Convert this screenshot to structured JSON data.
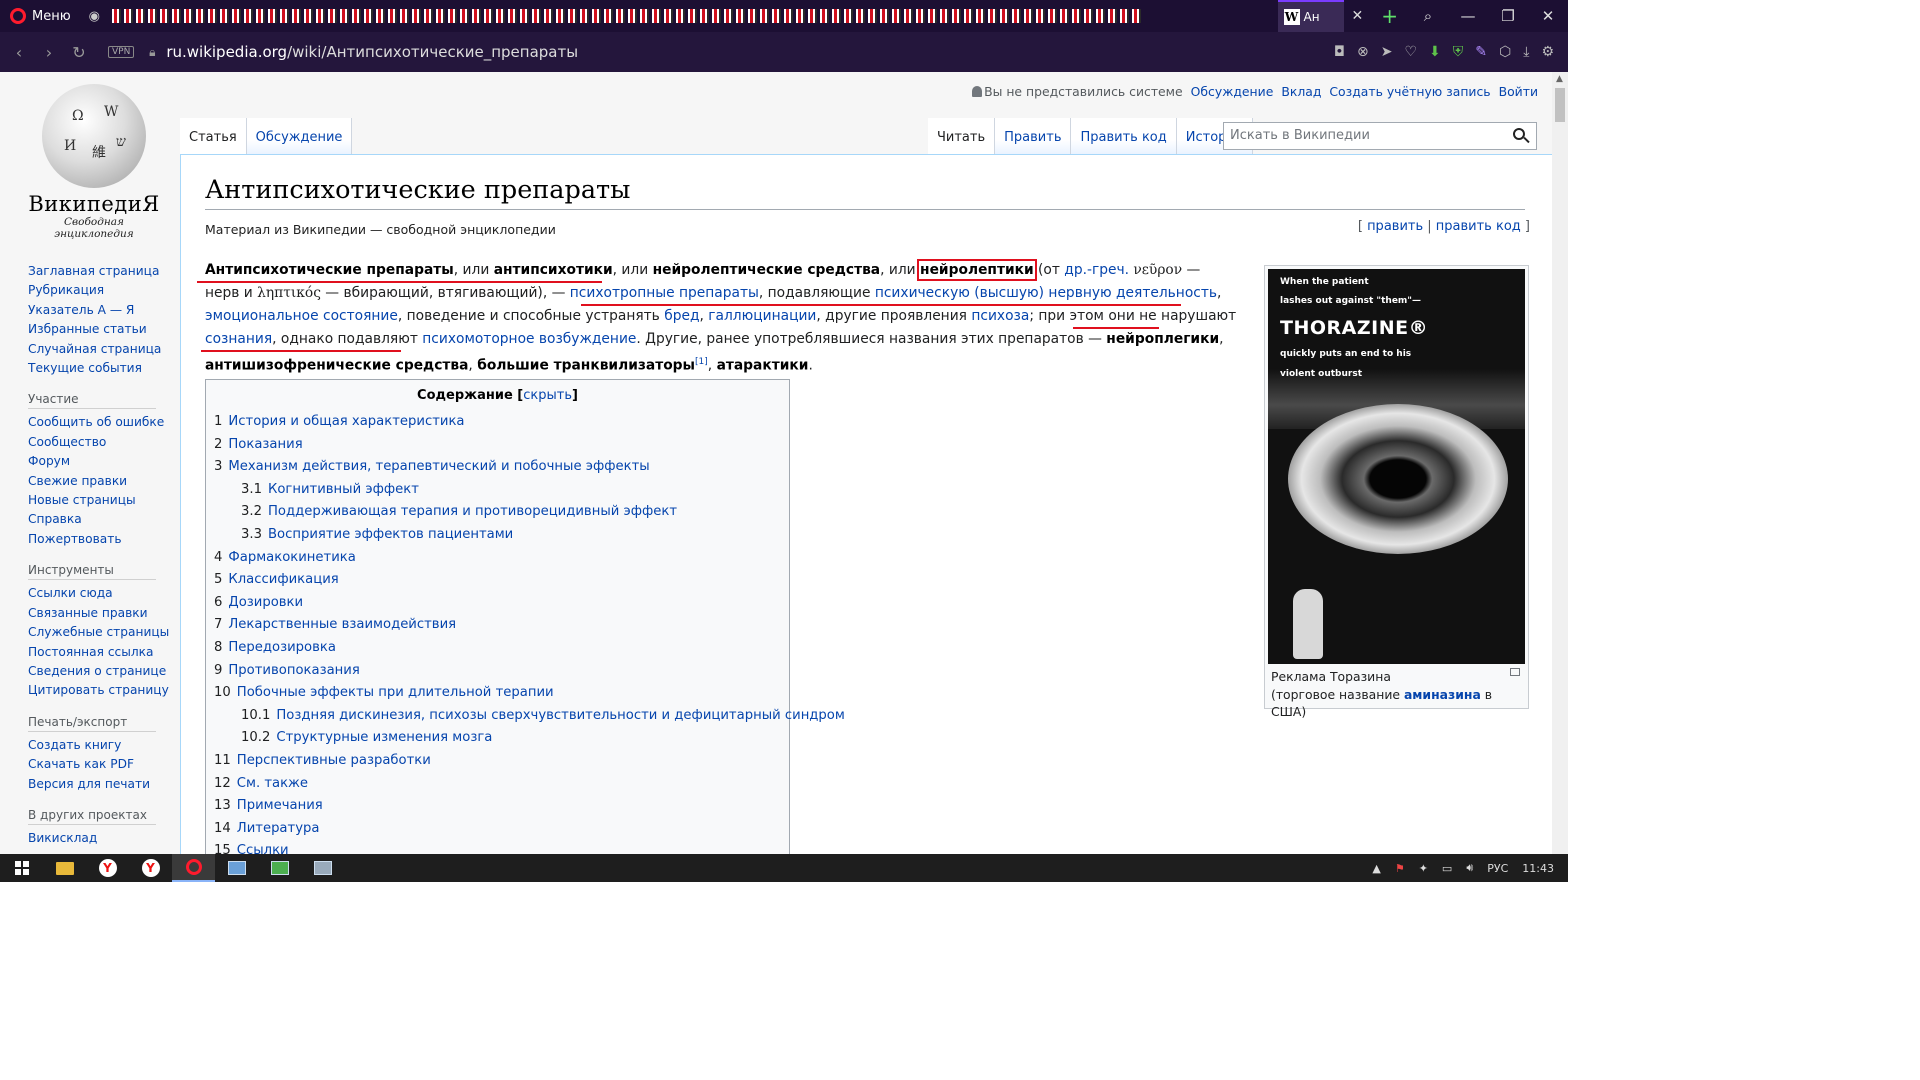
{
  "browser": {
    "menu_label": "Меню",
    "active_tab_title": "Ан",
    "url_host": "ru.wikipedia.org",
    "url_path": "/wiki/Антипсихотические_препараты",
    "vpn_label": "VPN"
  },
  "wiki": {
    "logo_title": "ВикипедиЯ",
    "logo_subtitle": "Свободная энциклопедия",
    "nav_main": [
      "Заглавная страница",
      "Рубрикация",
      "Указатель А — Я",
      "Избранные статьи",
      "Случайная страница",
      "Текущие события"
    ],
    "participation_heading": "Участие",
    "nav_participation": [
      "Сообщить об ошибке",
      "Сообщество",
      "Форум",
      "Свежие правки",
      "Новые страницы",
      "Справка",
      "Пожертвовать"
    ],
    "tools_heading": "Инструменты",
    "nav_tools": [
      "Ссылки сюда",
      "Связанные правки",
      "Служебные страницы",
      "Постоянная ссылка",
      "Сведения о странице",
      "Цитировать страницу"
    ],
    "print_heading": "Печать/экспорт",
    "nav_print": [
      "Создать книгу",
      "Скачать как PDF",
      "Версия для печати"
    ],
    "projects_heading": "В других проектах",
    "nav_projects": [
      "Викисклад"
    ],
    "personal": {
      "anon": "Вы не представились системе",
      "talk": "Обсуждение",
      "contrib": "Вклад",
      "create": "Создать учётную запись",
      "login": "Войти"
    },
    "tabs_left": [
      "Статья",
      "Обсуждение"
    ],
    "tabs_right": [
      "Читать",
      "Править",
      "Править код",
      "История"
    ],
    "search_placeholder": "Искать в Википедии",
    "title": "Антипсихотические препараты",
    "from": "Материал из Википедии — свободной энциклопедии",
    "edit": "править",
    "edit_code": "править код",
    "toc_title": "Содержание",
    "toc_toggle": "скрыть",
    "toc": [
      {
        "n": "1",
        "t": "История и общая характеристика",
        "l": 1
      },
      {
        "n": "2",
        "t": "Показания",
        "l": 1
      },
      {
        "n": "3",
        "t": "Механизм действия, терапевтический и побочные эффекты",
        "l": 1
      },
      {
        "n": "3.1",
        "t": "Когнитивный эффект",
        "l": 2
      },
      {
        "n": "3.2",
        "t": "Поддерживающая терапия и противорецидивный эффект",
        "l": 2
      },
      {
        "n": "3.3",
        "t": "Восприятие эффектов пациентами",
        "l": 2
      },
      {
        "n": "4",
        "t": "Фармакокинетика",
        "l": 1
      },
      {
        "n": "5",
        "t": "Классификация",
        "l": 1
      },
      {
        "n": "6",
        "t": "Дозировки",
        "l": 1
      },
      {
        "n": "7",
        "t": "Лекарственные взаимодействия",
        "l": 1
      },
      {
        "n": "8",
        "t": "Передозировка",
        "l": 1
      },
      {
        "n": "9",
        "t": "Противопоказания",
        "l": 1
      },
      {
        "n": "10",
        "t": "Побочные эффекты при длительной терапии",
        "l": 1
      },
      {
        "n": "10.1",
        "t": "Поздняя дискинезия, психозы сверхчувствительности и дефицитарный синдром",
        "l": 2
      },
      {
        "n": "10.2",
        "t": "Структурные изменения мозга",
        "l": 2
      },
      {
        "n": "11",
        "t": "Перспективные разработки",
        "l": 1
      },
      {
        "n": "12",
        "t": "См. также",
        "l": 1
      },
      {
        "n": "13",
        "t": "Примечания",
        "l": 1
      },
      {
        "n": "14",
        "t": "Литература",
        "l": 1
      },
      {
        "n": "15",
        "t": "Ссылки",
        "l": 1
      }
    ],
    "ad": {
      "line1": "When the patient",
      "line2": "lashes out against \"them\"—",
      "brand": "THORAZINE®",
      "line3": "quickly puts an end to his",
      "line4": "violent outburst"
    },
    "caption_line1": "Реклама Торазина",
    "caption_pre": "(торговое название ",
    "caption_link": "аминазина",
    "caption_post": " в США)"
  },
  "taskbar": {
    "lang": "РУС",
    "time": "11:43"
  }
}
